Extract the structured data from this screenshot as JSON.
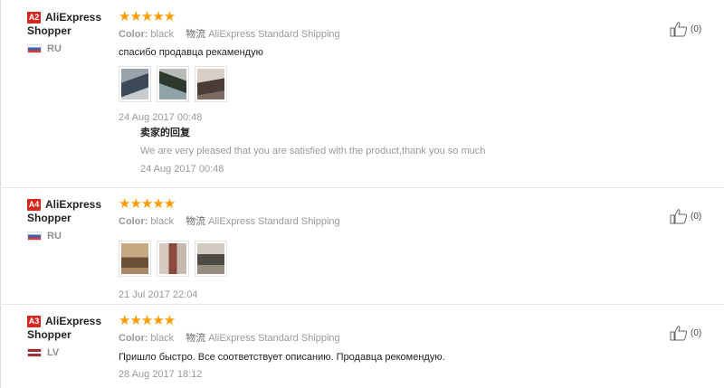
{
  "reviews": [
    {
      "badge": "A2",
      "user_name_line1": "AliExpress",
      "user_name_line2": "Shopper",
      "country_code": "RU",
      "flag": "ru",
      "stars": "★★★★★",
      "color_key": "Color:",
      "color_value": "black",
      "shipping_key": "物流",
      "shipping_value": "AliExpress Standard Shipping",
      "text": "спасибо продавца рекамендую",
      "photos": [
        {
          "icon": "review-photo",
          "tone": "#3b4a56"
        },
        {
          "icon": "review-photo",
          "tone": "#2f3a2e"
        },
        {
          "icon": "review-photo",
          "tone": "#4a3d38"
        }
      ],
      "date": "24 Aug 2017 00:48",
      "reply": {
        "title": "卖家的回复",
        "text": "We are very pleased that you are satisfied with the product,thank you so much",
        "date": "24 Aug 2017 00:48"
      },
      "likes": "(0)"
    },
    {
      "badge": "A4",
      "user_name_line1": "AliExpress",
      "user_name_line2": "Shopper",
      "country_code": "RU",
      "flag": "ru",
      "stars": "★★★★★",
      "color_key": "Color:",
      "color_value": "black",
      "shipping_key": "物流",
      "shipping_value": "AliExpress Standard Shipping",
      "text": "",
      "photos": [
        {
          "icon": "review-photo",
          "tone": "#6b5038"
        },
        {
          "icon": "review-photo",
          "tone": "#8a4a3e"
        },
        {
          "icon": "review-photo",
          "tone": "#4e4a44"
        }
      ],
      "date": "21 Jul 2017 22:04",
      "likes": "(0)"
    },
    {
      "badge": "A3",
      "user_name_line1": "AliExpress",
      "user_name_line2": "Shopper",
      "country_code": "LV",
      "flag": "lv",
      "stars": "★★★★★",
      "color_key": "Color:",
      "color_value": "black",
      "shipping_key": "物流",
      "shipping_value": "AliExpress Standard Shipping",
      "text": "Пришло быстро. Все соответствует описанию. Продавца рекомендую.",
      "date": "28 Aug 2017 18:12",
      "likes": "(0)"
    }
  ],
  "colors": {
    "stars": "#ff9a00",
    "badge": "#d9261c"
  }
}
